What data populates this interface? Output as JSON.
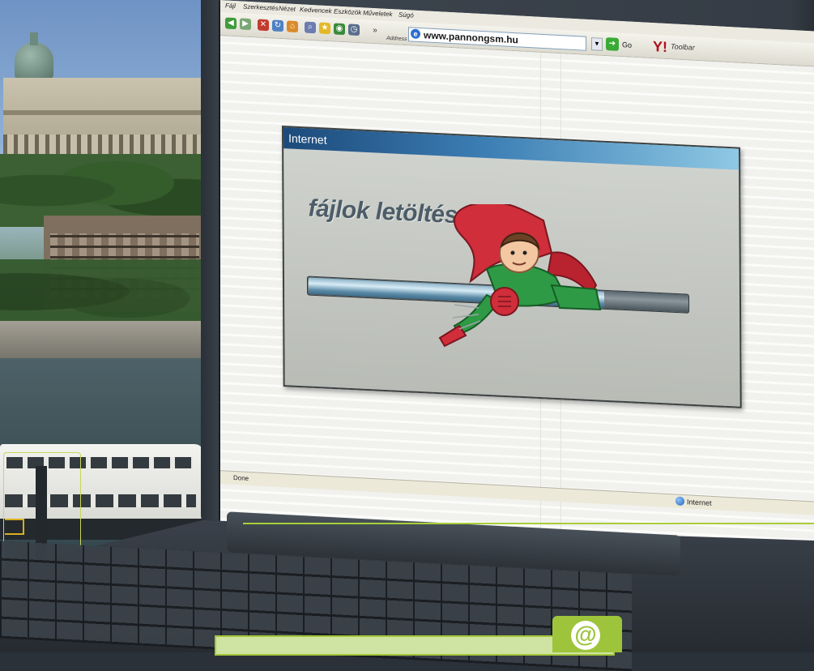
{
  "browser": {
    "menu": [
      "Fájl",
      "Szerkesztés",
      "Nézet",
      "Kedvencek",
      "Eszközök",
      "Műveletek",
      "Súgó"
    ],
    "address_label": "Address",
    "url": "www.pannongsm.hu",
    "go_label": "Go",
    "yahoo_logo": "Y!",
    "toolbar_label": "Toolbar",
    "status_left": "Done",
    "status_zone": "Internet"
  },
  "dialog": {
    "title": "Internet",
    "heading": "fájlok letöltése",
    "progress": 0.78
  },
  "page_texts": [],
  "colors": {
    "dialog_title_start": "#1c4a7a",
    "dialog_title_end": "#8ec8e4",
    "accent_green": "#9ec43b",
    "go_green": "#3aaa35"
  },
  "badge": {
    "icon": "@"
  }
}
